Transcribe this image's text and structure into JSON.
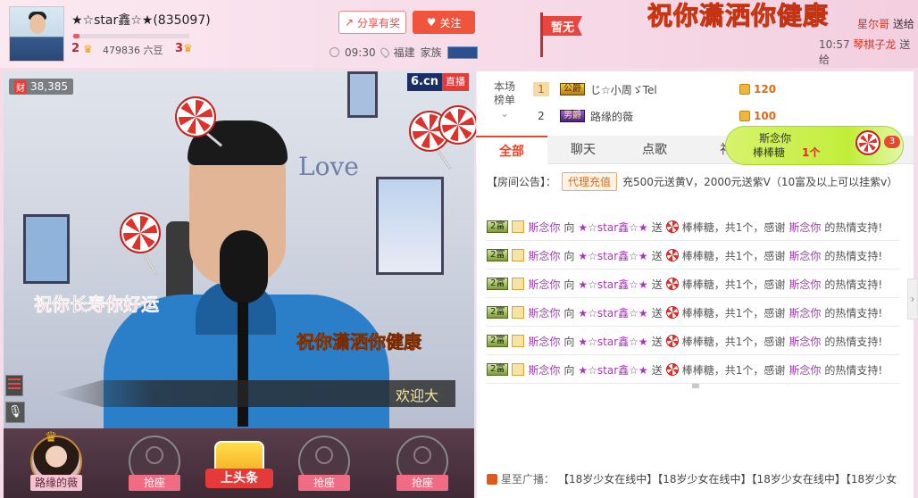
{
  "header": {
    "anchor_name": "★☆star鑫☆★(835097)",
    "fortune_level": "2",
    "beans": "479836 六豆",
    "charm_level": "3",
    "level_progress": 0.05,
    "share_label": "分享有奖",
    "follow_label": "关注",
    "time": "09:30",
    "location": "福建",
    "family_label": "家族",
    "flag_label": "暂无",
    "banner_text": "祝你潇洒你健康",
    "banner_right_name": "星尔哥",
    "banner_right_action": "送给",
    "banner_right_time": "10:57",
    "banner_right_user": "琴棋子龙",
    "banner_right_suffix": "送给"
  },
  "video": {
    "wealth_icon": "财",
    "wealth_count": "38,385",
    "logo": "6.cn",
    "live_label": "直播",
    "wish_text_1": "祝你长寿你好运",
    "wish_text_2": "祝你潇洒你健康",
    "welcome_text": "欢迎大",
    "love_text": "Love",
    "mic_icon": "microphone-icon"
  },
  "seats": {
    "user_name": "路缘的薇",
    "grab_label": "抢座",
    "headline_label": "上头条"
  },
  "ranking": {
    "label_line1": "本场",
    "label_line2": "榜单",
    "rows": [
      {
        "rank": "1",
        "badge": "公爵",
        "name": "じ☆小周ゞTel",
        "amount": "120"
      },
      {
        "rank": "2",
        "badge": "男爵",
        "name": "路缘的薇",
        "amount": "100"
      }
    ]
  },
  "tabs": [
    "全部",
    "聊天",
    "点歌",
    "礼"
  ],
  "gift_popup": {
    "sender": "斯念你",
    "gift_name": "棒棒糖",
    "count": "1个",
    "badge": "3"
  },
  "notice": {
    "label": "【房间公告】：",
    "tag": "代理充值",
    "text": "充500元送黄V，2000元送紫V（10富及以上可以挂紫v）"
  },
  "messages": [
    {
      "badge": "2富",
      "sender": "斯念你",
      "verb": "向",
      "receiver": "★☆star鑫☆★",
      "send": "送",
      "gift": "棒棒糖，共1个，感谢",
      "thanks_user": "斯念你",
      "suffix": "的热情支持!"
    },
    {
      "badge": "2富",
      "sender": "斯念你",
      "verb": "向",
      "receiver": "★☆star鑫☆★",
      "send": "送",
      "gift": "棒棒糖，共1个，感谢",
      "thanks_user": "斯念你",
      "suffix": "的热情支持!"
    },
    {
      "badge": "2富",
      "sender": "斯念你",
      "verb": "向",
      "receiver": "★☆star鑫☆★",
      "send": "送",
      "gift": "棒棒糖，共1个，感谢",
      "thanks_user": "斯念你",
      "suffix": "的热情支持!"
    },
    {
      "badge": "2富",
      "sender": "斯念你",
      "verb": "向",
      "receiver": "★☆star鑫☆★",
      "send": "送",
      "gift": "棒棒糖，共1个，感谢",
      "thanks_user": "斯念你",
      "suffix": "的热情支持!"
    },
    {
      "badge": "2富",
      "sender": "斯念你",
      "verb": "向",
      "receiver": "★☆star鑫☆★",
      "send": "送",
      "gift": "棒棒糖，共1个，感谢",
      "thanks_user": "斯念你",
      "suffix": "的热情支持!"
    },
    {
      "badge": "2富",
      "sender": "斯念你",
      "verb": "向",
      "receiver": "★☆star鑫☆★",
      "send": "送",
      "gift": "棒棒糖，共1个，感谢",
      "thanks_user": "斯念你",
      "suffix": "的热情支持!"
    }
  ],
  "broadcast": {
    "label": "星至广播：",
    "text": "【18岁少女在线中】【18岁少女在线中】【18岁少女在线中】【18岁少女"
  },
  "colors": {
    "accent": "#e8472c",
    "follow": "#f0553c",
    "page_bg": "#f6dbe8",
    "username": "#a43ab3"
  }
}
